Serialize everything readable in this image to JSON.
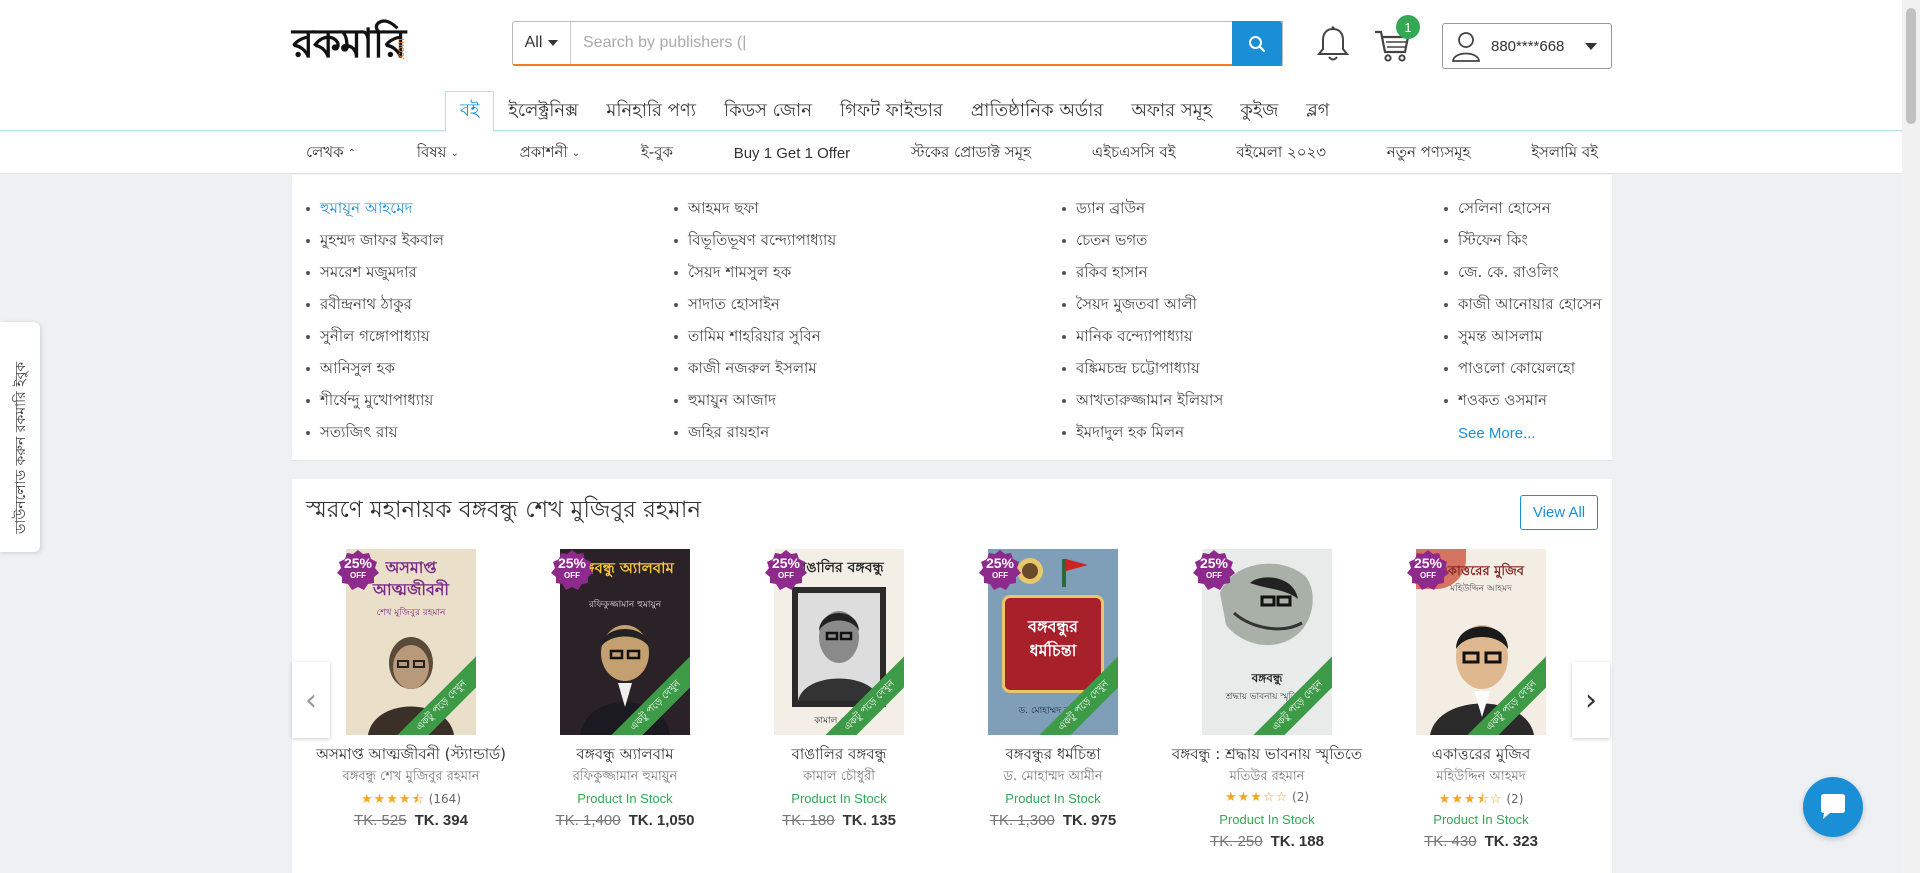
{
  "brand": {
    "logo_text": "রকমারি",
    "logo_suffix": ".com",
    "accent": "#f47b20",
    "primary": "#1b8fd6"
  },
  "search": {
    "category": "All",
    "placeholder": "Search by publishers (|",
    "icon": "search-icon"
  },
  "header": {
    "cart_count": "1",
    "user_phone": "880****668",
    "icons": [
      "bell-icon",
      "cart-icon",
      "user-icon"
    ]
  },
  "main_tabs": [
    {
      "label": "বই",
      "active": true
    },
    {
      "label": "ইলেক্ট্রনিক্স"
    },
    {
      "label": "মনিহারি পণ্য"
    },
    {
      "label": "কিডস জোন"
    },
    {
      "label": "গিফট ফাইন্ডার"
    },
    {
      "label": "প্রাতিষ্ঠানিক অর্ডার"
    },
    {
      "label": "অফার সমূহ"
    },
    {
      "label": "কুইজ"
    },
    {
      "label": "ব্লগ"
    }
  ],
  "sub_nav": [
    {
      "label": "লেখক",
      "chevron": "up"
    },
    {
      "label": "বিষয়",
      "chevron": "down"
    },
    {
      "label": "প্রকাশনী",
      "chevron": "down"
    },
    {
      "label": "ই-বুক"
    },
    {
      "label": "Buy 1 Get 1 Offer"
    },
    {
      "label": "স্টকের প্রোডাক্ট সমূহ"
    },
    {
      "label": "এইচএসসি বই"
    },
    {
      "label": "বইমেলা ২০২৩"
    },
    {
      "label": "নতুন পণ্যসমূহ"
    },
    {
      "label": "ইসলামি বই"
    }
  ],
  "authors": {
    "col1": [
      "হুমায়ূন আহমেদ",
      "মুহম্মদ জাফর ইকবাল",
      "সমরেশ মজুমদার",
      "রবীন্দ্রনাথ ঠাকুর",
      "সুনীল গঙ্গোপাধ্যায়",
      "আনিসুল হক",
      "শীর্ষেন্দু মুখোপাধ্যায়",
      "সত্যজিৎ রায়"
    ],
    "col2": [
      "আহমদ ছফা",
      "বিভূতিভূষণ বন্দ্যোপাধ্যায়",
      "সৈয়দ শামসুল হক",
      "সাদাত হোসাইন",
      "তামিম শাহরিয়ার সুবিন",
      "কাজী নজরুল ইসলাম",
      "হুমায়ুন আজাদ",
      "জহির রায়হান"
    ],
    "col3": [
      "ড্যান ব্রাউন",
      "চেতন ভগত",
      "রকিব হাসান",
      "সৈয়দ মুজতবা আলী",
      "মানিক বন্দ্যোপাধ্যায়",
      "বঙ্কিমচন্দ্র চট্টোপাধ্যায়",
      "আখতারুজ্জামান ইলিয়াস",
      "ইমদাদুল হক মিলন"
    ],
    "col4": [
      "সেলিনা হোসেন",
      "স্টিফেন কিং",
      "জে. কে. রাওলিং",
      "কাজী আনোয়ার হোসেন",
      "সুমন্ত আসলাম",
      "পাওলো কোয়েলহো",
      "শওকত ওসমান"
    ],
    "see_more": "See More..."
  },
  "section": {
    "title": "স্মরণে মহানায়ক বঙ্গবন্ধু শেখ মুজিবুর রহমান",
    "view_all": "View All",
    "discount_pct": "25%",
    "discount_off": "OFF",
    "ribbon": "একটু পড়ে দেখুন",
    "stock_label": "Product In Stock",
    "products": [
      {
        "cover_title": "অসমাপ্ত আত্মজীবনী",
        "cover_sub": "শেখ মুজিবুর রহমান",
        "title": "অসমাপ্ত আত্মজীবনী (স্ট্যান্ডার্ড)",
        "author": "বঙ্গবন্ধু শেখ মুজিবুর রহমান",
        "rating": 4.5,
        "reviews": "(164)",
        "old_price": "TK. 525",
        "new_price": "TK. 394"
      },
      {
        "cover_title": "বঙ্গবন্ধু অ্যালবাম",
        "cover_sub": "রফিকুজ্জামান হুমায়ুন",
        "title": "বঙ্গবন্ধু অ্যালবাম",
        "author": "রফিকুজ্জামান হুমায়ুন",
        "in_stock": true,
        "old_price": "TK. 1,400",
        "new_price": "TK. 1,050"
      },
      {
        "cover_title": "বাঙালির বঙ্গবন্ধু",
        "cover_sub": "কামাল চৌধুরী",
        "title": "বাঙালির বঙ্গবন্ধু",
        "author": "কামাল চৌধুরী",
        "in_stock": true,
        "old_price": "TK. 180",
        "new_price": "TK. 135"
      },
      {
        "cover_title": "বঙ্গবন্ধুর ধর্মচিন্তা",
        "cover_sub": "ড. মোহাম্মদ আমীন",
        "title": "বঙ্গবন্ধুর ধর্মচিন্তা",
        "author": "ড. মোহাম্মদ আমীন",
        "in_stock": true,
        "old_price": "TK. 1,300",
        "new_price": "TK. 975"
      },
      {
        "cover_title": "বঙ্গবন্ধু",
        "cover_sub": "শ্রদ্ধায় ভাবনায় স্মৃতিতে",
        "title": "বঙ্গবন্ধু : শ্রদ্ধায় ভাবনায় স্মৃতিতে",
        "author": "মতিউর রহমান",
        "rating": 3,
        "reviews": "(2)",
        "in_stock": true,
        "old_price": "TK. 250",
        "new_price": "TK. 188"
      },
      {
        "cover_title": "একাত্তরের মুজিব",
        "cover_sub": "মহিউদ্দিন আহমদ",
        "title": "একাত্তরের মুজিব",
        "author": "মহিউদ্দিন আহমদ",
        "rating": 3.5,
        "reviews": "(2)",
        "in_stock": true,
        "old_price": "TK. 430",
        "new_price": "TK. 323"
      }
    ]
  },
  "side_tab": {
    "label": "ডাউনলোড করুন রকমারি ইবুক"
  }
}
